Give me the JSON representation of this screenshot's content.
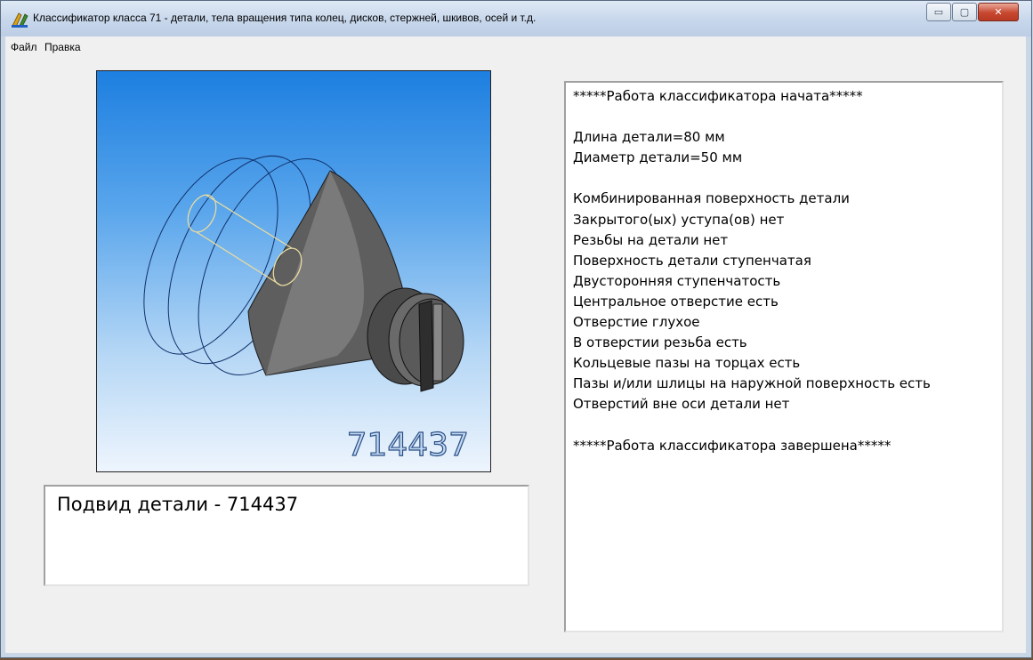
{
  "window": {
    "title": "Классификатор класса 71 - детали, тела вращения типа колец, дисков, стержней, шкивов, осей и т.д.",
    "minimize_label": "▭",
    "maximize_label": "▢",
    "close_label": "✕"
  },
  "menu": {
    "file": "Файл",
    "edit": "Правка"
  },
  "preview": {
    "code": "714437"
  },
  "subtype": {
    "text": "Подвид детали - 714437"
  },
  "log": {
    "lines": [
      "*****Работа классификатора начата*****",
      "",
      "Длина детали=80 мм",
      "Диаметр детали=50 мм",
      "",
      "Комбинированная поверхность детали",
      "Закрытого(ых) уступа(ов) нет",
      "Резьбы на детали нет",
      "Поверхность детали ступенчатая",
      "Двусторонняя ступенчатость",
      "Центральное отверстие есть",
      "Отверстие глухое",
      "В отверстии резьба есть",
      "Кольцевые пазы на торцах есть",
      "Пазы и/или шлицы на наружной поверхность есть",
      "Отверстий вне оси детали нет",
      "",
      "*****Работа классификатора завершена*****"
    ]
  },
  "colors": {
    "preview_top": "#1d7fe0",
    "preview_bottom": "#eef5fd",
    "part_gray": "#6b6b6b"
  }
}
